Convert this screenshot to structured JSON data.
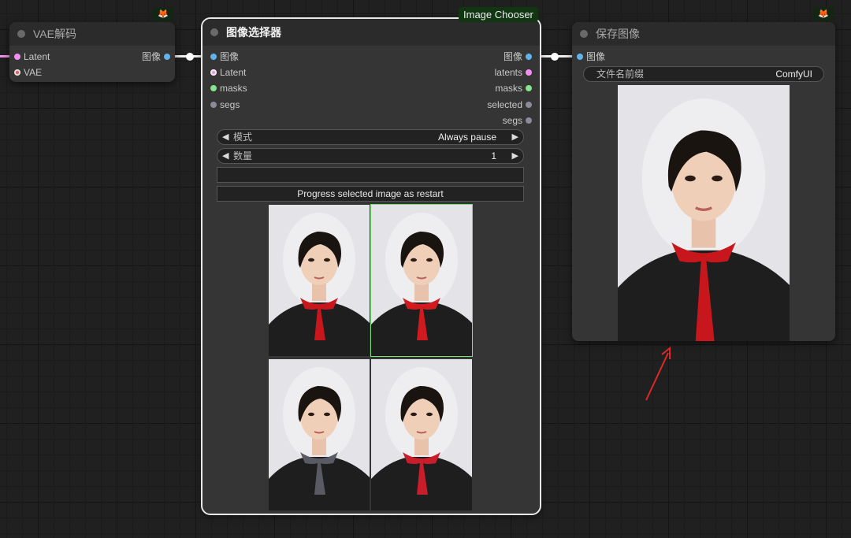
{
  "vae_node": {
    "title": "VAE解码",
    "inputs": [
      {
        "label": "Latent",
        "color": "#f38ff0"
      },
      {
        "label": "VAE",
        "color": "#e25a5a"
      }
    ],
    "output_label": "图像"
  },
  "chooser_node": {
    "badge": "Image Chooser",
    "title": "图像选择器",
    "inputs": [
      "图像",
      "Latent",
      "masks",
      "segs"
    ],
    "outputs": [
      "图像",
      "latents",
      "masks",
      "selected",
      "segs"
    ],
    "mode": {
      "label": "模式",
      "value": "Always pause"
    },
    "count": {
      "label": "数量",
      "value": "1"
    },
    "text_value": "",
    "progress_button": "Progress selected image as restart",
    "selected_index": 1,
    "scarf_colors": [
      "#c8161d",
      "#d01a1f",
      "#5a5a64",
      "#c81d2a"
    ]
  },
  "save_node": {
    "title": "保存图像",
    "input_label": "图像",
    "prefix_label": "文件名前缀",
    "prefix_value": "ComfyUI"
  },
  "icons": {
    "fox": "fox-logo-icon",
    "arrow_left": "arrow-left-icon",
    "arrow_right": "arrow-right-icon"
  },
  "colors": {
    "image": "#62b2ec",
    "latent": "#f38ff0",
    "vae": "#e25a5a",
    "mask": "#8be28a",
    "segs": "#8a8a9a",
    "selected_border": "#7be07a",
    "annotation": "#e02828"
  }
}
